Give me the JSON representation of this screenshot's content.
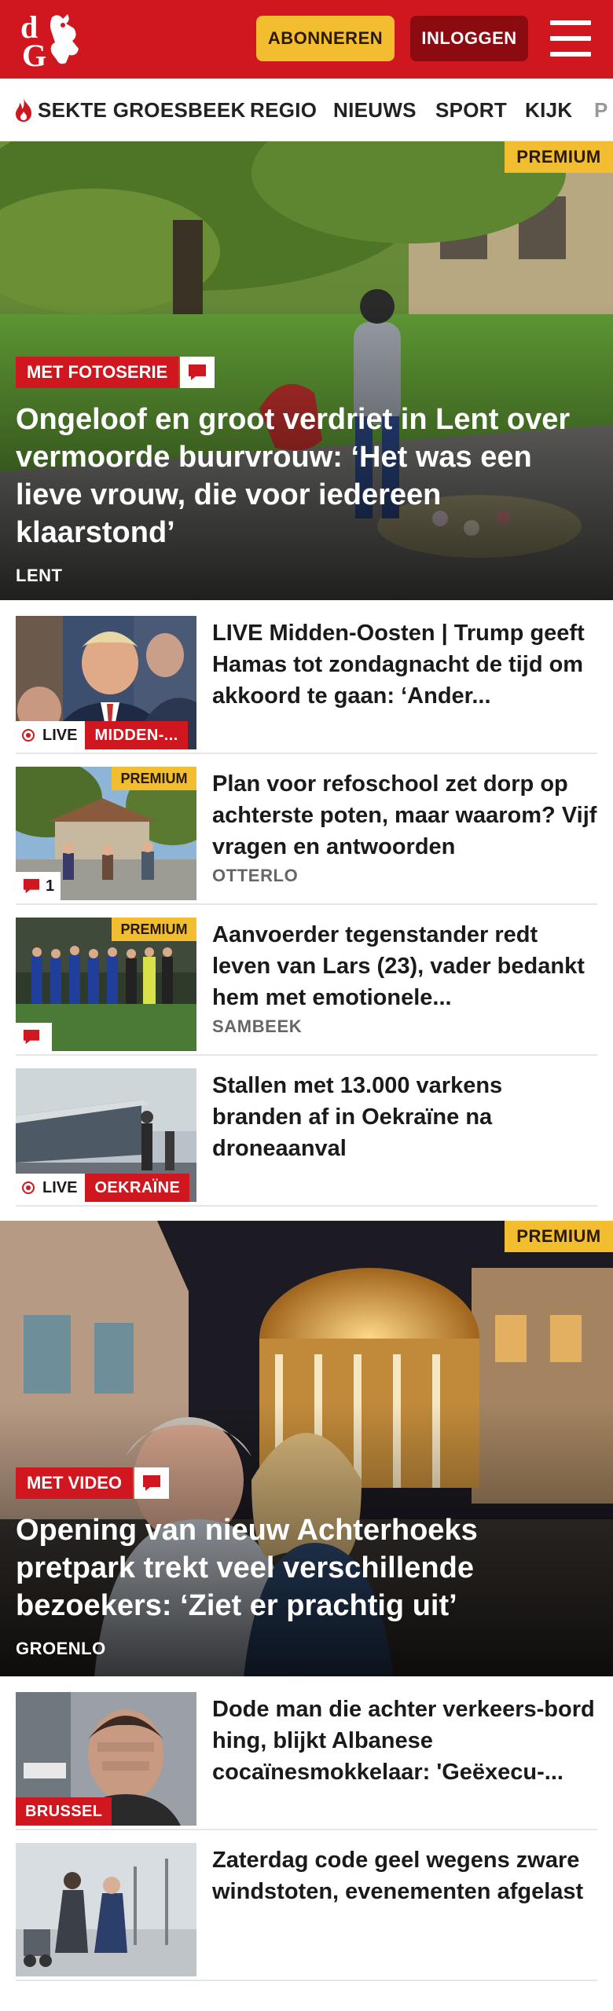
{
  "header": {
    "logo_text": "dG",
    "subscribe_label": "ABONNEREN",
    "login_label": "INLOGGEN"
  },
  "nav": {
    "items": [
      "SEKTE GROESBEEK",
      "REGIO",
      "NIEUWS",
      "SPORT",
      "KIJK",
      "P"
    ]
  },
  "hero1": {
    "premium": "PREMIUM",
    "media_label": "MET FOTOSERIE",
    "title": "Ongeloof en groot verdriet in Lent over vermoorde buurvrouw: ‘Het was een lieve vrouw, die voor iedereen klaarstond’",
    "location": "LENT"
  },
  "articles": [
    {
      "title": "LIVE Midden-Oosten | Trump geeft Hamas tot zondagnacht de tijd om akkoord te gaan: ‘Ander...",
      "live": "LIVE",
      "tag": "MIDDEN-...",
      "premium": "",
      "comments": "",
      "location": ""
    },
    {
      "title": "Plan voor refoschool zet dorp op achterste poten, maar waarom? Vijf vragen en antwoorden",
      "live": "",
      "tag": "",
      "premium": "PREMIUM",
      "comments": "1",
      "location": "OTTERLO"
    },
    {
      "title": "Aanvoerder tegenstander redt leven van Lars (23), vader bedankt hem met emotionele...",
      "live": "",
      "tag": "",
      "premium": "PREMIUM",
      "comments": "",
      "location": "SAMBEEK"
    },
    {
      "title": "Stallen met 13.000 varkens branden af in Oekraïne na droneaanval",
      "live": "LIVE",
      "tag": "OEKRAÏNE",
      "premium": "",
      "comments": "",
      "location": ""
    }
  ],
  "hero2": {
    "premium": "PREMIUM",
    "media_label": "MET VIDEO",
    "title": "Opening van nieuw Achterhoeks pretpark trekt veel verschillende bezoekers: ‘Ziet er prachtig uit’",
    "location": "GROENLO"
  },
  "articles2": [
    {
      "title": "Dode man die achter verkeers-bord hing, blijkt Albanese cocaïnesmokkelaar: 'Geëxecu-...",
      "tag": "BRUSSEL"
    },
    {
      "title": "Zaterdag code geel wegens zware windstoten, evenementen afgelast",
      "tag": ""
    }
  ],
  "colors": {
    "brand_red": "#d0161e",
    "premium_yellow": "#f2bd2e",
    "login_dark_red": "#8c0b10"
  },
  "icons": [
    "flame-icon",
    "comment-icon",
    "menu-icon",
    "live-dot-icon"
  ]
}
